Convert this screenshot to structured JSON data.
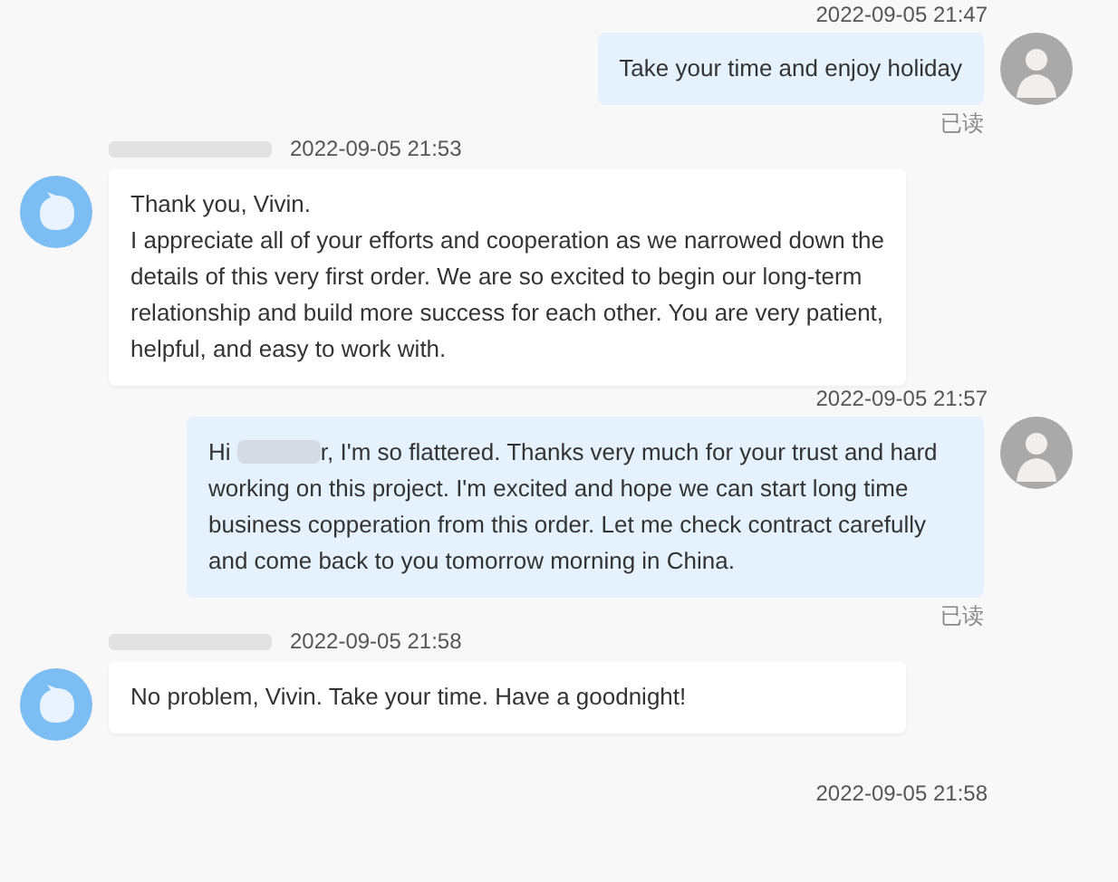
{
  "messages": [
    {
      "kind": "outgoing",
      "time": "2022-09-05 21:47",
      "parts": [
        "Take your time and enjoy holiday"
      ],
      "read_status": "已读"
    },
    {
      "kind": "incoming",
      "time": "2022-09-05 21:53",
      "parts": [
        "Thank you, Vivin.\nI appreciate all of your efforts and cooperation as we narrowed down the details of this very first order. We are so excited to begin our long-term relationship and build more success for each other. You are very patient, helpful, and easy to work with."
      ]
    },
    {
      "kind": "outgoing",
      "time": "2022-09-05 21:57",
      "parts": [
        "Hi ",
        "r, I'm so flattered. Thanks very much for your trust and hard working on this project. I'm excited and hope we can start long time business copperation from this order. Let me check contract carefully and come back to you tomorrow morning in China."
      ],
      "read_status": "已读"
    },
    {
      "kind": "incoming",
      "time": "2022-09-05 21:58",
      "parts": [
        "No problem, Vivin. Take your time. Have a goodnight!"
      ]
    },
    {
      "kind": "timestamp",
      "time": "2022-09-05 21:58"
    }
  ]
}
